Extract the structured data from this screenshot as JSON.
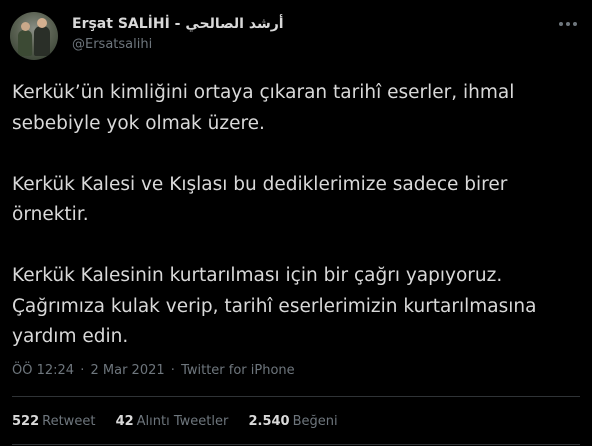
{
  "tweet": {
    "author_name": "Erşat SALİHİ - أرشد الصالحي",
    "author_handle": "@Ersatsalihi",
    "more_icon": "more-dots-icon",
    "paragraphs": [
      "Kerkük’ün kimliğini ortaya çıkaran tarihî eserler, ihmal sebebiyle yok olmak üzere.",
      "Kerkük Kalesi ve Kışlası bu dediklerimize sadece birer örnektir.",
      "Kerkük Kalesinin kurtarılması için bir çağrı yapıyoruz. Çağrımıza kulak verip, tarihî eserlerimizin kurtarılmasına yardım edin."
    ],
    "time": "ÖÖ 12:24",
    "date": "2 Mar 2021",
    "source": "Twitter for iPhone",
    "separator": "·"
  },
  "stats": {
    "retweets_count": "522",
    "retweets_label": "Retweet",
    "quotes_count": "42",
    "quotes_label": "Alıntı Tweetler",
    "likes_count": "2.540",
    "likes_label": "Beğeni"
  },
  "colors": {
    "background": "#000000",
    "text": "#d9d9d9",
    "muted": "#6e767d",
    "divider": "#2f3336"
  }
}
